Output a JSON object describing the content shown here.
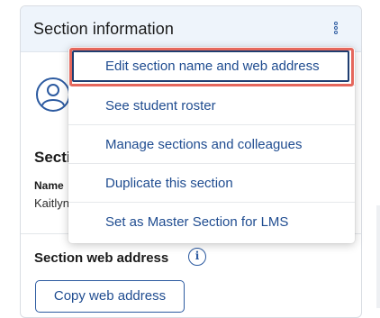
{
  "panel": {
    "title": "Section information",
    "more_icon": "kebab-vertical-icon",
    "avatar_icon": "user-avatar-icon",
    "section_label_partial": "Secti",
    "name_label_partial": "Name",
    "name_value_partial": "Kaitlyn",
    "web_address_label": "Section web address",
    "info_icon": "info-icon",
    "info_glyph": "i",
    "copy_button": "Copy web address"
  },
  "menu": {
    "items": [
      {
        "label": "Edit section name and web address",
        "focused": true
      },
      {
        "label": "See student roster"
      },
      {
        "label": "Manage sections and colleagues"
      },
      {
        "label": "Duplicate this section"
      },
      {
        "label": "Set as Master Section for LMS"
      }
    ]
  },
  "colors": {
    "accent": "#2c5aa0",
    "header_bg": "#eef4fb",
    "focus_outline": "#e5675c"
  }
}
